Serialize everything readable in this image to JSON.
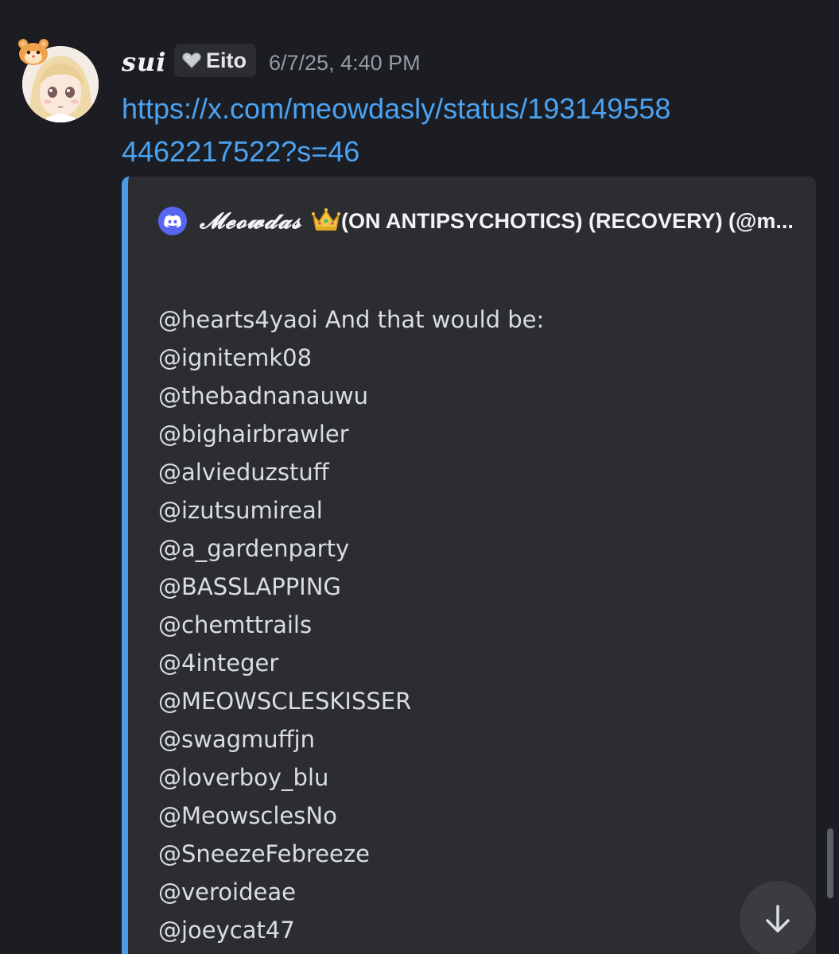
{
  "message": {
    "author": {
      "username": "sui",
      "clan_tag": "Eito",
      "timestamp": "6/7/25, 4:40 PM"
    },
    "link": "https://x.com/meowdasly/status/1931495584462217522?s=46",
    "embed": {
      "accent_color": "#4d9de6",
      "author_prefix": "𝓜𝓮𝓸𝔀𝓭𝓪𝓼",
      "author_suffix": "(ON ANTIPSYCHOTICS) (RECOVERY) (@m...",
      "description_lines": [
        "@hearts4yaoi And that would be:",
        "@ignitemk08",
        "@thebadnanauwu",
        "@bighairbrawler",
        "@alvieduzstuff",
        "@izutsumireal",
        "@a_gardenparty",
        "@BASSLAPPING",
        "@chemttrails",
        "@4integer",
        "@MEOWSCLESKISSER",
        "@swagmuffjn",
        "@loverboy_blu",
        "@MeowsclesNo",
        "@SneezeFebreeze",
        "@veroideae",
        "@joeycat47"
      ]
    }
  },
  "icons": {
    "clan_badge": "heart-icon",
    "embed_provider": "discord-icon",
    "crown": "crown-icon",
    "jump": "arrow-down-icon"
  },
  "colors": {
    "background": "#1c1d22",
    "link": "#4aa3f2",
    "embed_bg": "#2b2d31"
  }
}
